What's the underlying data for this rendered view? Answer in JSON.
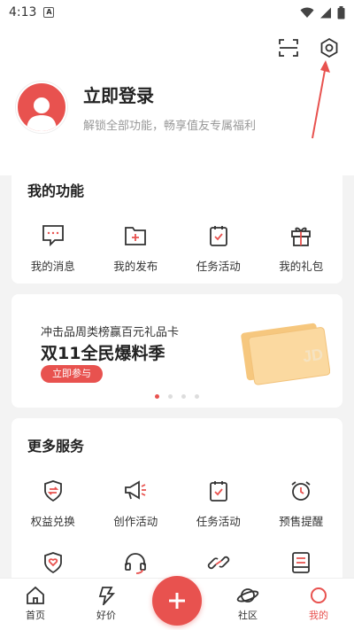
{
  "status_bar": {
    "time": "4:13",
    "a_badge": "A"
  },
  "header": {
    "scan_icon": "scan-icon",
    "settings_icon": "settings-gear-icon"
  },
  "profile": {
    "login_label": "立即登录",
    "subtitle": "解锁全部功能，畅享值友专属福利"
  },
  "my_functions": {
    "title": "我的功能",
    "items": [
      {
        "label": "我的消息",
        "icon": "message-icon"
      },
      {
        "label": "我的发布",
        "icon": "publish-icon"
      },
      {
        "label": "任务活动",
        "icon": "task-icon"
      },
      {
        "label": "我的礼包",
        "icon": "gift-icon"
      }
    ]
  },
  "banner": {
    "subtitle": "冲击品周类榜赢百元礼品卡",
    "title": "双11全民爆料季",
    "button_label": "立即参与",
    "card_mark": "JD",
    "current_slide": 1,
    "slide_count": 4
  },
  "more_services": {
    "title": "更多服务",
    "row1": [
      {
        "label": "权益兑换",
        "icon": "exchange-shield-icon"
      },
      {
        "label": "创作活动",
        "icon": "megaphone-icon"
      },
      {
        "label": "任务活动",
        "icon": "task-icon"
      },
      {
        "label": "预售提醒",
        "icon": "alarm-clock-icon"
      }
    ],
    "row2": [
      {
        "icon": "heart-shield-icon"
      },
      {
        "icon": "headset-icon"
      },
      {
        "icon": "link-icon"
      },
      {
        "icon": "document-icon"
      }
    ]
  },
  "bottom_nav": {
    "items": [
      {
        "label": "首页",
        "icon": "home-icon"
      },
      {
        "label": "好价",
        "icon": "lightning-icon"
      },
      {
        "label": "社区",
        "icon": "planet-icon"
      },
      {
        "label": "我的",
        "icon": "profile-circle-icon"
      }
    ],
    "active": "我的",
    "fab_icon": "plus-icon"
  },
  "colors": {
    "accent": "#e8524f",
    "background": "#f3f3f3"
  }
}
